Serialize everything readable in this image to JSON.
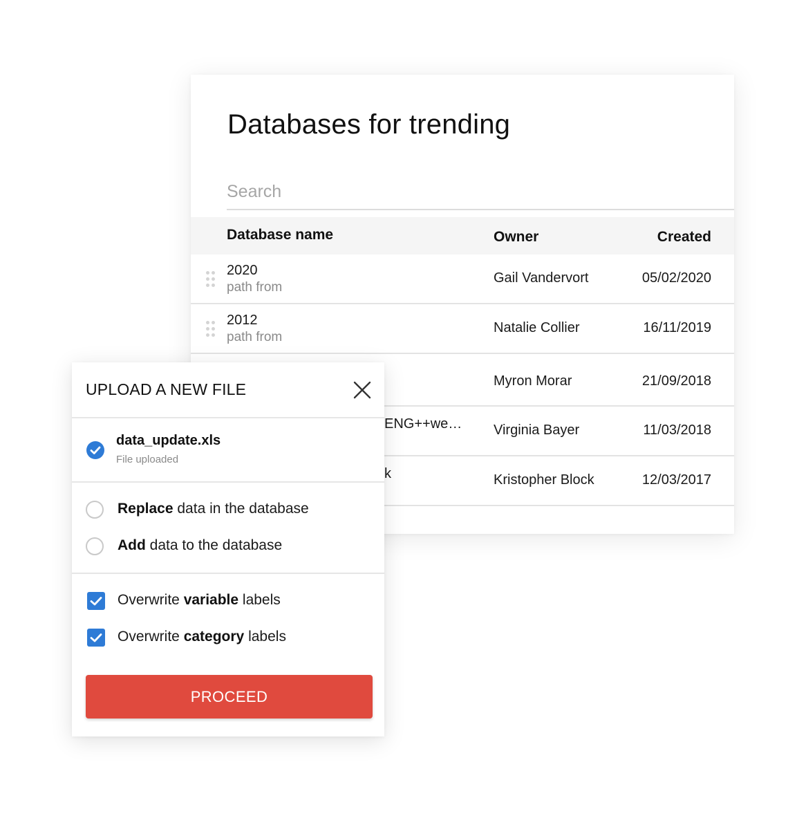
{
  "databases": {
    "title": "Databases for trending",
    "search": {
      "placeholder": "Search",
      "value": ""
    },
    "columns": {
      "name": "Database name",
      "owner": "Owner",
      "created": "Created"
    },
    "rows": [
      {
        "name": "2020",
        "path": "path from",
        "owner": "Gail Vandervort",
        "created": "05/02/2020"
      },
      {
        "name": "2012",
        "path": "path from",
        "owner": "Natalie Collier",
        "created": "16/11/2019"
      },
      {
        "name": "",
        "path": "",
        "owner": "Myron Morar",
        "created": "21/09/2018"
      },
      {
        "name": "ENG++we…",
        "path": "",
        "owner": "Virginia Bayer",
        "created": "11/03/2018"
      },
      {
        "name": "k",
        "path": "",
        "owner": "Kristopher Block",
        "created": "12/03/2017"
      }
    ]
  },
  "upload_dialog": {
    "title": "UPLOAD A NEW FILE",
    "file": {
      "name": "data_update.xls",
      "status": "File uploaded"
    },
    "mode_options": [
      {
        "bold": "Replace",
        "rest": " data in the database",
        "selected": false
      },
      {
        "bold": "Add",
        "rest": " data to the database",
        "selected": false
      }
    ],
    "overwrite_options": [
      {
        "prefix": "Overwrite ",
        "bold": "variable",
        "suffix": " labels",
        "checked": true
      },
      {
        "prefix": "Overwrite ",
        "bold": "category",
        "suffix": " labels",
        "checked": true
      }
    ],
    "proceed_label": "PROCEED"
  },
  "colors": {
    "accent_blue": "#2e7bd6",
    "proceed_red": "#e04a3e"
  },
  "icons": {
    "close": "close-icon",
    "file_check": "check-circle-icon",
    "drag": "drag-handle-icon",
    "checkbox": "checkbox-checked-icon"
  }
}
